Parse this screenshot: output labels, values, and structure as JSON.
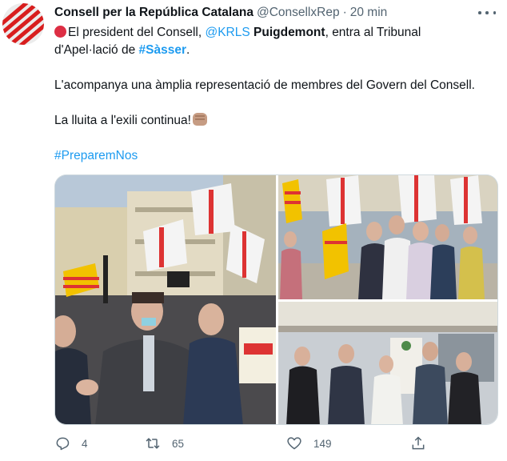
{
  "tweet": {
    "author_name": "Consell per la República Catalana",
    "author_handle": "@ConsellxRep",
    "separator": "·",
    "time": "20 min",
    "line1": {
      "pre": "El president del Consell, ",
      "mention": "@KRLS",
      "bold": "Puigdemont",
      "post": ", entra al Tribunal"
    },
    "line2": {
      "pre": "d'Apel·lació de ",
      "hashtag": "#Sàsser",
      "post": "."
    },
    "para2": "L'acompanya una àmplia representació de membres del Govern del Consell.",
    "para3": "La lluita a l'exili continua!",
    "hashtag_line": "#PreparemNos"
  },
  "stats": {
    "replies": "4",
    "retweets": "65",
    "likes": "149"
  },
  "icons": {
    "avatar": "consell-logo",
    "emoji_1": "red-circle",
    "emoji_2": "raised-fist",
    "more": "more-dots-icon",
    "reply": "reply-icon",
    "retweet": "retweet-icon",
    "like": "heart-icon",
    "share": "share-icon"
  },
  "colors": {
    "link": "#1d9bf0",
    "text": "#0f1419",
    "secondary": "#536471",
    "logo_red": "#d81e1e"
  }
}
